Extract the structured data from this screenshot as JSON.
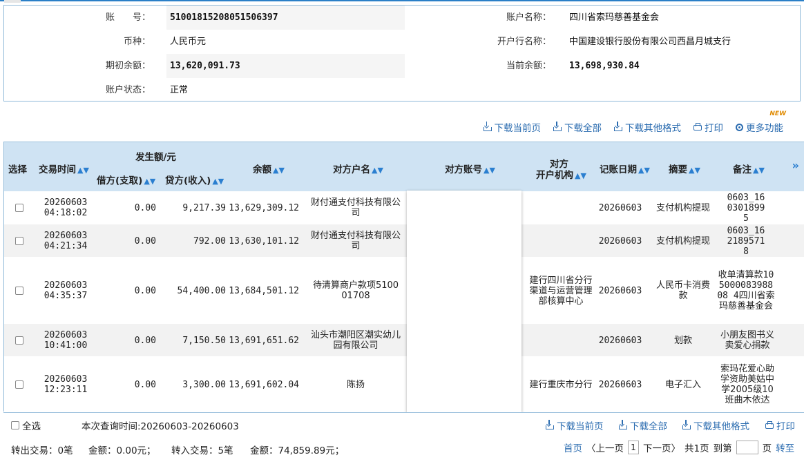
{
  "account": {
    "labels": {
      "account_no": "账　　号：",
      "currency": "币种：",
      "opening_balance": "期初余额：",
      "status": "账户状态：",
      "account_name": "账户名称：",
      "bank_name": "开户行名称：",
      "current_balance": "当前余额："
    },
    "account_no": "51001815208051506397",
    "currency": "人民币元",
    "opening_balance": "13,620,091.73",
    "status": "正常",
    "account_name": "四川省索玛慈善基金会",
    "bank_name": "中国建设银行股份有限公司西昌月城支行",
    "current_balance": "13,698,930.84"
  },
  "toolbar": {
    "download_page": "下载当前页",
    "download_all": "下载全部",
    "download_other": "下载其他格式",
    "print": "打印",
    "more": "更多功能",
    "new_badge": "NEW"
  },
  "table": {
    "headers": {
      "select": "选择",
      "time": "交易时间",
      "amount_group": "发生额/元",
      "debit": "借方(支取)",
      "credit": "贷方(收入)",
      "balance": "余额",
      "counterparty_name": "对方户名",
      "counterparty_account": "对方账号",
      "counterparty_bank_l1": "对方",
      "counterparty_bank_l2": "开户机构",
      "post_date": "记账日期",
      "summary": "摘要",
      "remark": "备注"
    },
    "sort_icon": "▲▼",
    "more_icon": "»",
    "rows": [
      {
        "date": "20260603",
        "time": "04:18:02",
        "debit": "0.00",
        "credit": "9,217.39",
        "balance": "13,629,309.12",
        "name": "财付通支付科技有限公司",
        "bank": "",
        "post": "20260603",
        "summary": "支付机构提现",
        "remark": "0603_1603018995"
      },
      {
        "date": "20260603",
        "time": "04:21:34",
        "debit": "0.00",
        "credit": "792.00",
        "balance": "13,630,101.12",
        "name": "财付通支付科技有限公司",
        "bank": "",
        "post": "20260603",
        "summary": "支付机构提现",
        "remark": "0603_1621895718"
      },
      {
        "date": "20260603",
        "time": "04:35:37",
        "debit": "0.00",
        "credit": "54,400.00",
        "balance": "13,684,501.12",
        "name": "待清算商户款项510001708",
        "bank": "建行四川省分行渠道与运营管理部核算中心",
        "post": "20260603",
        "summary": "人民币卡消费款",
        "remark": "收单清算款10500008398808 4四川省索玛慈善基金会"
      },
      {
        "date": "20260603",
        "time": "10:41:00",
        "debit": "0.00",
        "credit": "7,150.50",
        "balance": "13,691,651.62",
        "name": "汕头市潮阳区潮实幼儿园有限公司",
        "bank": "",
        "post": "20260603",
        "summary": "划款",
        "remark": "小朋友图书义卖爱心捐款"
      },
      {
        "date": "20260603",
        "time": "12:23:11",
        "debit": "0.00",
        "credit": "3,300.00",
        "balance": "13,691,602.04",
        "name": "陈扬",
        "bank": "建行重庆市分行",
        "post": "20260603",
        "summary": "电子汇入",
        "remark": "索玛花爱心助学资助美姑中学2005级10班曲木依达"
      }
    ]
  },
  "footer": {
    "select_all": "全选",
    "query_period": "本次查询时间:20260603-20260603",
    "download_page": "下载当前页",
    "download_all": "下载全部",
    "download_other": "下载其他格式",
    "print": "打印",
    "out_count": "转出交易：0笔",
    "out_amount": "金额：0.00元；",
    "in_count": "转入交易：5笔",
    "in_amount": "金额：74,859.89元；",
    "pager": {
      "first": "首页",
      "prev": "〈上一页",
      "current": "1",
      "next": "下一页〉",
      "total": "共1页",
      "goto_prefix": "到第",
      "goto_suffix": "页",
      "go": "转至"
    }
  }
}
